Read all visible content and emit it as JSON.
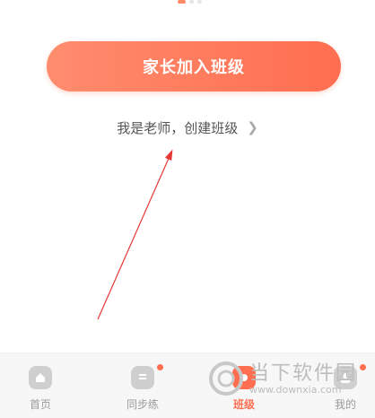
{
  "join_button_label": "家长加入班级",
  "teacher_link_label": "我是老师，创建班级",
  "tabs": [
    {
      "label": "首页",
      "icon": "home-icon",
      "active": false,
      "badge": false
    },
    {
      "label": "同步练",
      "icon": "practice-icon",
      "active": false,
      "badge": true
    },
    {
      "label": "班级",
      "icon": "class-icon",
      "active": true,
      "badge": false
    },
    {
      "label": "我的",
      "icon": "profile-icon",
      "active": false,
      "badge": true
    }
  ],
  "watermark": {
    "title": "当下软件园",
    "url": "www.downxia.com"
  },
  "colors": {
    "accent": "#ff6e50",
    "annotation_arrow": "#e53935"
  }
}
